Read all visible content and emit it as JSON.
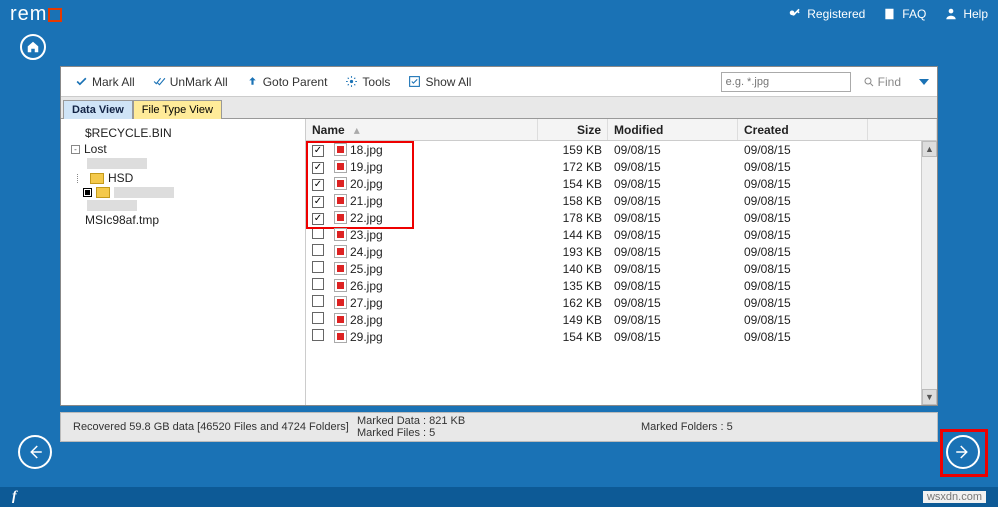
{
  "header": {
    "brand": "rem",
    "registered": "Registered",
    "faq": "FAQ",
    "help": "Help"
  },
  "toolbar": {
    "mark_all": "Mark All",
    "unmark_all": "UnMark All",
    "goto_parent": "Goto Parent",
    "tools": "Tools",
    "show_all": "Show All",
    "search_placeholder": "e.g. *.jpg",
    "find": "Find"
  },
  "tabs": {
    "data_view": "Data View",
    "file_type_view": "File Type View"
  },
  "tree": {
    "recycle": "$RECYCLE.BIN",
    "lost": "Lost",
    "hsd": "HSD",
    "msic": "MSIc98af.tmp"
  },
  "columns": {
    "name": "Name",
    "size": "Size",
    "modified": "Modified",
    "created": "Created"
  },
  "files": [
    {
      "checked": true,
      "name": "18.jpg",
      "size": "159 KB",
      "modified": "09/08/15",
      "created": "09/08/15"
    },
    {
      "checked": true,
      "name": "19.jpg",
      "size": "172 KB",
      "modified": "09/08/15",
      "created": "09/08/15"
    },
    {
      "checked": true,
      "name": "20.jpg",
      "size": "154 KB",
      "modified": "09/08/15",
      "created": "09/08/15"
    },
    {
      "checked": true,
      "name": "21.jpg",
      "size": "158 KB",
      "modified": "09/08/15",
      "created": "09/08/15"
    },
    {
      "checked": true,
      "name": "22.jpg",
      "size": "178 KB",
      "modified": "09/08/15",
      "created": "09/08/15"
    },
    {
      "checked": false,
      "name": "23.jpg",
      "size": "144 KB",
      "modified": "09/08/15",
      "created": "09/08/15"
    },
    {
      "checked": false,
      "name": "24.jpg",
      "size": "193 KB",
      "modified": "09/08/15",
      "created": "09/08/15"
    },
    {
      "checked": false,
      "name": "25.jpg",
      "size": "140 KB",
      "modified": "09/08/15",
      "created": "09/08/15"
    },
    {
      "checked": false,
      "name": "26.jpg",
      "size": "135 KB",
      "modified": "09/08/15",
      "created": "09/08/15"
    },
    {
      "checked": false,
      "name": "27.jpg",
      "size": "162 KB",
      "modified": "09/08/15",
      "created": "09/08/15"
    },
    {
      "checked": false,
      "name": "28.jpg",
      "size": "149 KB",
      "modified": "09/08/15",
      "created": "09/08/15"
    },
    {
      "checked": false,
      "name": "29.jpg",
      "size": "154 KB",
      "modified": "09/08/15",
      "created": "09/08/15"
    }
  ],
  "status": {
    "recovered": "Recovered 59.8 GB data [46520 Files and 4724 Folders]",
    "marked_data": "Marked Data : 821 KB",
    "marked_files": "Marked Files : 5",
    "marked_folders": "Marked Folders : 5"
  },
  "watermark": "wsxdn.com"
}
